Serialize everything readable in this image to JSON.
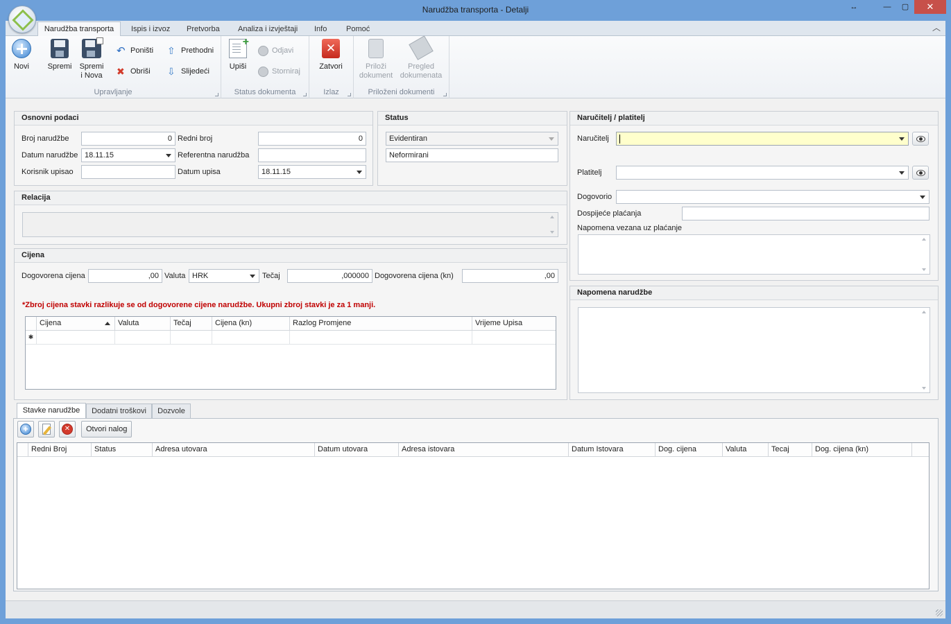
{
  "window": {
    "title": "Narudžba transporta - Detalji",
    "restore_glyph": "↔",
    "minimize_glyph": "—",
    "maximize_glyph": "▢",
    "close_glyph": "✕"
  },
  "ribbon": {
    "tabs": [
      "Narudžba transporta",
      "Ispis i izvoz",
      "Pretvorba",
      "Analiza i izvještaji",
      "Info",
      "Pomoć"
    ],
    "collapse_glyph": "︿",
    "groups": {
      "upravljanje": {
        "label": "Upravljanje",
        "novi": "Novi",
        "spremi": "Spremi",
        "spremi_nova_1": "Spremi",
        "spremi_nova_2": "i Nova",
        "ponisti": "Poništi",
        "obrisi": "Obriši",
        "prethodni": "Prethodni",
        "sljedeci": "Slijedeći"
      },
      "status": {
        "label": "Status dokumenta",
        "upisi": "Upiši",
        "odjavi": "Odjavi",
        "storniraj": "Storniraj"
      },
      "izlaz": {
        "label": "Izlaz",
        "zatvori": "Zatvori"
      },
      "prilozeni": {
        "label": "Priloženi dokumenti",
        "prilozi_1": "Priloži",
        "prilozi_2": "dokument",
        "pregled_1": "Pregled",
        "pregled_2": "dokumenata"
      }
    }
  },
  "osnovni": {
    "title": "Osnovni podaci",
    "broj_narudzbe_label": "Broj narudžbe",
    "broj_narudzbe": "0",
    "redni_broj_label": "Redni broj",
    "redni_broj": "0",
    "datum_narudzbe_label": "Datum narudžbe",
    "datum_narudzbe": "18.11.15",
    "referentna_label": "Referentna narudžba",
    "referentna": "",
    "korisnik_label": "Korisnik upisao",
    "korisnik": "",
    "datum_upisa_label": "Datum upisa",
    "datum_upisa": "18.11.15"
  },
  "status": {
    "title": "Status",
    "value1": "Evidentiran",
    "value2": "Neformirani"
  },
  "narucitelj": {
    "title": "Naručitelj / platitelj",
    "narucitelj_label": "Naručitelj",
    "narucitelj": "",
    "platitelj_label": "Platitelj",
    "platitelj": "",
    "dogovorio_label": "Dogovorio",
    "dogovorio": "",
    "dospijece_label": "Dospijeće plaćanja",
    "dospijece": "",
    "napomena_placanje_label": "Napomena vezana uz plaćanje"
  },
  "relacija": {
    "title": "Relacija"
  },
  "cijena": {
    "title": "Cijena",
    "dogovorena_label": "Dogovorena cijena",
    "dogovorena": ",00",
    "valuta_label": "Valuta",
    "valuta": "HRK",
    "tecaj_label": "Tečaj",
    "tecaj": ",000000",
    "dogovorena_kn_label": "Dogovorena cijena (kn)",
    "dogovorena_kn": ",00",
    "warning": "*Zbroj cijena stavki razlikuje se od dogovorene cijene narudžbe. Ukupni zbroj stavki je za 1 manji.",
    "columns": [
      "Cijena",
      "Valuta",
      "Tečaj",
      "Cijena (kn)",
      "Razlog Promjene",
      "Vrijeme Upisa"
    ],
    "new_row_glyph": "✱"
  },
  "napomena": {
    "title": "Napomena narudžbe"
  },
  "bottom": {
    "tabs": [
      "Stavke narudžbe",
      "Dodatni troškovi",
      "Dozvole"
    ],
    "otvori_nalog": "Otvori nalog",
    "columns": [
      "Redni Broj",
      "Status",
      "Adresa utovara",
      "Datum utovara",
      "Adresa istovara",
      "Datum Istovara",
      "Dog. cijena",
      "Valuta",
      "Tecaj",
      "Dog. cijena (kn)"
    ]
  },
  "colors": {
    "window_frame": "#6ea0d9",
    "warning_red": "#c00000",
    "highlight_input": "#ffffcc"
  }
}
